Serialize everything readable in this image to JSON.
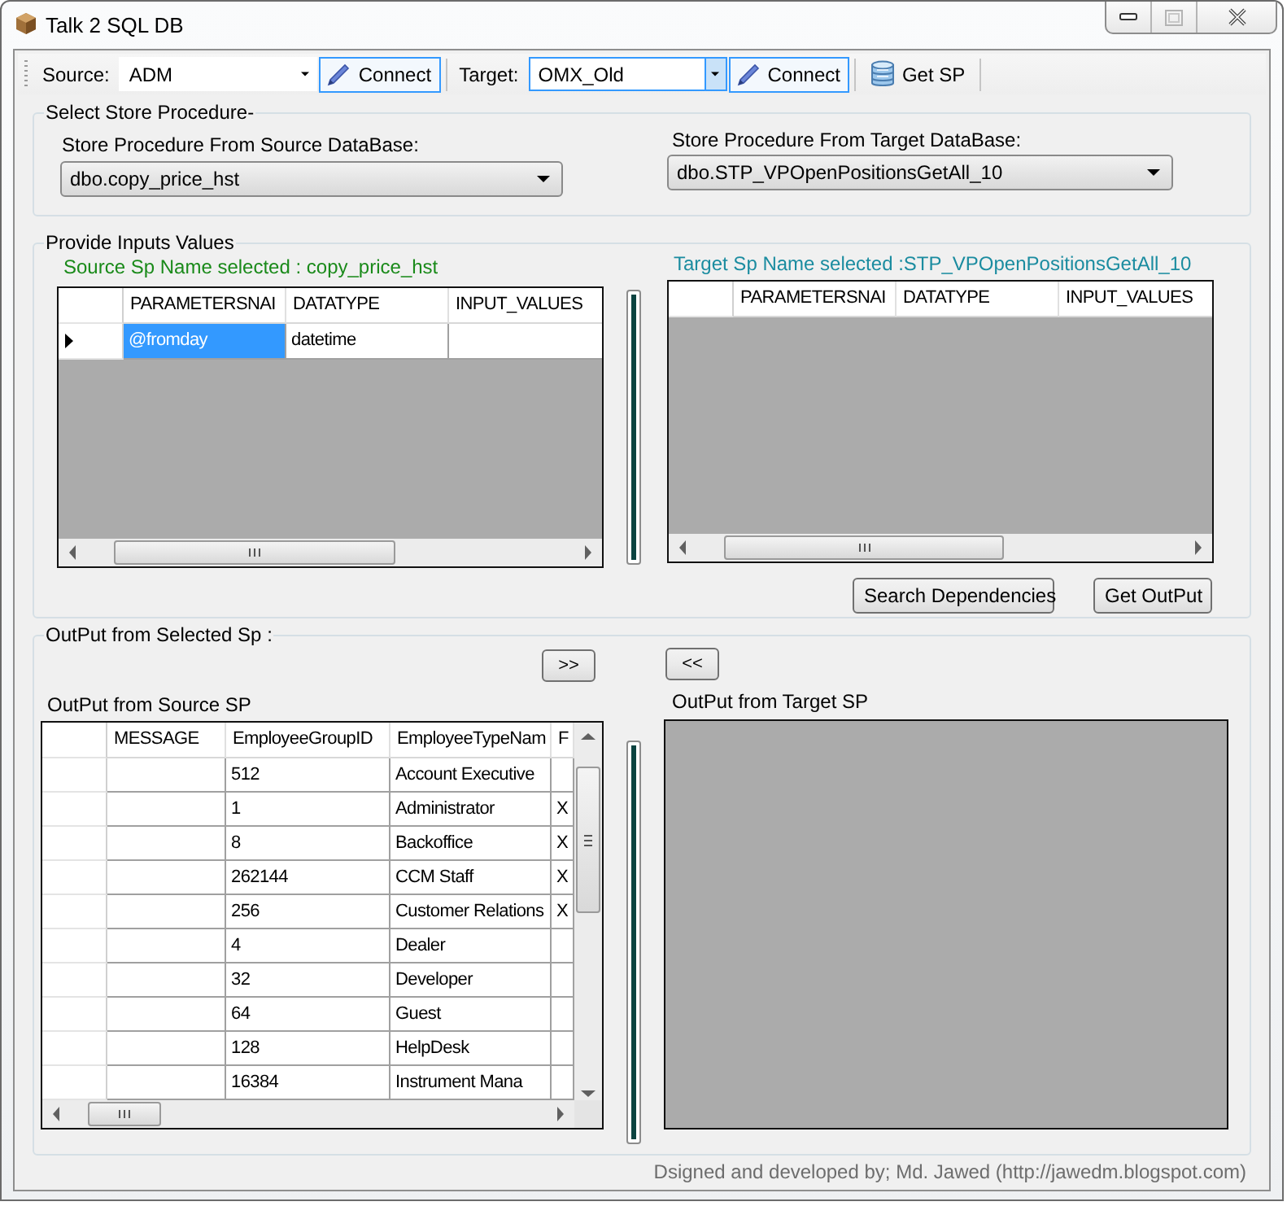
{
  "window": {
    "title": "Talk 2 SQL DB"
  },
  "toolbar": [
    {
      "kind": "label",
      "text": "Source:"
    },
    {
      "kind": "combo",
      "value": "ADM",
      "focused": false
    },
    {
      "kind": "connect",
      "text": "Connect",
      "highlighted": true
    },
    {
      "kind": "separator"
    },
    {
      "kind": "label",
      "text": "Target:"
    },
    {
      "kind": "combo",
      "value": "OMX_Old",
      "focused": true
    },
    {
      "kind": "connect",
      "text": "Connect",
      "highlighted": true
    },
    {
      "kind": "separator"
    },
    {
      "kind": "fetch",
      "text": "Get SP",
      "highlighted": false
    },
    {
      "kind": "separator"
    }
  ],
  "select_procedure": {
    "title": "Select Store Procedure-",
    "source": {
      "label": "Store Procedure From Source DataBase:",
      "value": "dbo.copy_price_hst"
    },
    "target": {
      "label": "Store Procedure From Target DataBase:",
      "value": "dbo.STP_VPOpenPositionsGetAll_10"
    }
  },
  "inputs": {
    "title": "Provide Inputs Values",
    "source": {
      "caption": "Source Sp Name selected : copy_price_hst",
      "columns": [
        "PARAMETERSNAI",
        "DATATYPE",
        "INPUT_VALUES"
      ],
      "rows": [
        {
          "current": true,
          "cells": [
            {
              "text": "@fromday",
              "selected": true
            },
            {
              "text": "datetime",
              "selected": false
            }
          ]
        }
      ]
    },
    "target": {
      "caption": "Target Sp Name selected :STP_VPOpenPositionsGetAll_10",
      "columns": [
        "PARAMETERSNAI",
        "DATATYPE",
        "INPUT_VALUES"
      ]
    },
    "buttons": [
      "Search Dependencies",
      "Get OutPut"
    ]
  },
  "output": {
    "title": "OutPut from Selected Sp :",
    "copy_right_button": ">>",
    "copy_left_button": "<<",
    "source": {
      "caption": "OutPut from Source SP",
      "columns": [
        "MESSAGE",
        "EmployeeGroupID",
        "EmployeeTypeNam",
        "F"
      ],
      "rows": [
        {
          "group_id": "512",
          "type_name": "Account Executive"
        },
        {
          "group_id": "1",
          "type_name": "Administrator",
          "flag": "X"
        },
        {
          "group_id": "8",
          "type_name": "Backoffice",
          "flag": "X"
        },
        {
          "group_id": "262144",
          "type_name": "CCM Staff",
          "flag": "X"
        },
        {
          "group_id": "256",
          "type_name": "Customer Relations",
          "flag": "X"
        },
        {
          "group_id": "4",
          "type_name": "Dealer"
        },
        {
          "group_id": "32",
          "type_name": "Developer"
        },
        {
          "group_id": "64",
          "type_name": "Guest"
        },
        {
          "group_id": "128",
          "type_name": "HelpDesk"
        },
        {
          "group_id": "16384",
          "type_name": "Instrument Mana"
        }
      ]
    },
    "target": {
      "caption": "OutPut from Target SP"
    }
  },
  "footer": "Dsigned and developed by; Md. Jawed (http://jawedm.blogspot.com)"
}
